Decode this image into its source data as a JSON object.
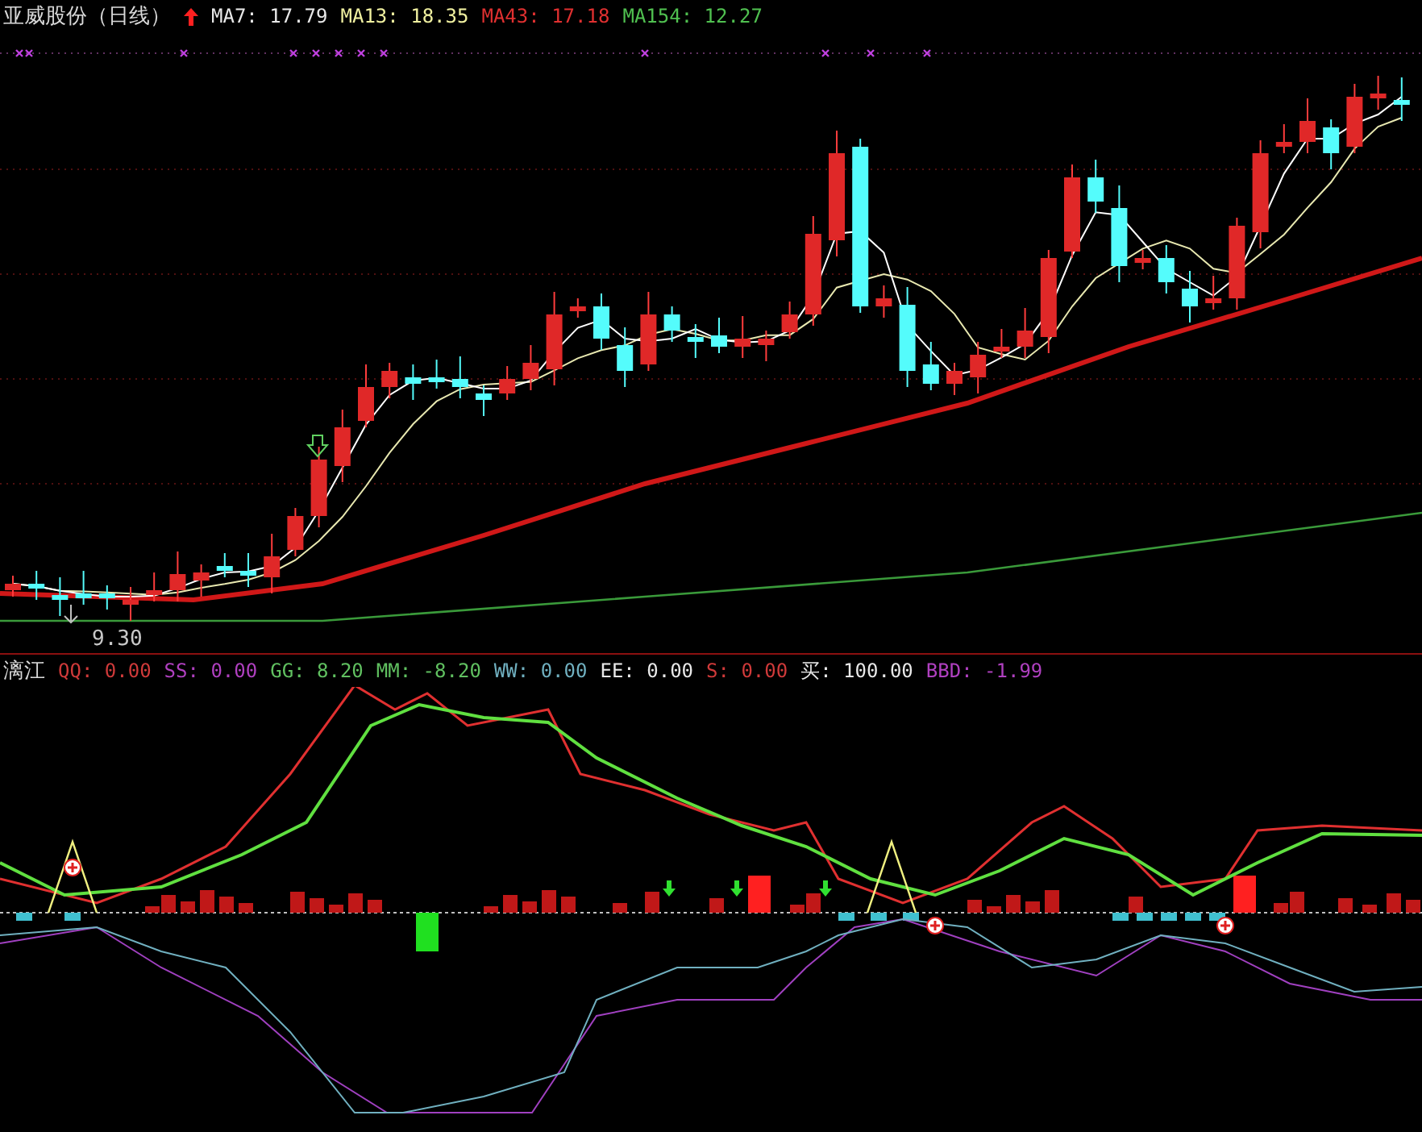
{
  "price_panel": {
    "title": "亚威股份（日线）",
    "indicators": [
      {
        "text": "MA7: 17.79",
        "color": "#e8e8e8"
      },
      {
        "text": "MA13: 18.35",
        "color": "#f0f0a0"
      },
      {
        "text": "MA43: 17.18",
        "color": "#e03030"
      },
      {
        "text": "MA154: 12.27",
        "color": "#50c050"
      }
    ],
    "low_label": "9.30"
  },
  "indicator_panel": {
    "title": "漓江",
    "indicators": [
      {
        "text": "QQ: 0.00",
        "color": "#d03a3a"
      },
      {
        "text": "SS: 0.00",
        "color": "#b040c0"
      },
      {
        "text": "GG: 8.20",
        "color": "#60c060"
      },
      {
        "text": "MM: -8.20",
        "color": "#60c060"
      },
      {
        "text": "WW: 0.00",
        "color": "#70b0c0"
      },
      {
        "text": "EE: 0.00",
        "color": "#e8e8e8"
      },
      {
        "text": "S: 0.00",
        "color": "#d03a3a"
      },
      {
        "text": "买: 100.00",
        "color": "#e8e8e8"
      },
      {
        "text": "BBD: -1.99",
        "color": "#b040c0"
      }
    ]
  }
}
